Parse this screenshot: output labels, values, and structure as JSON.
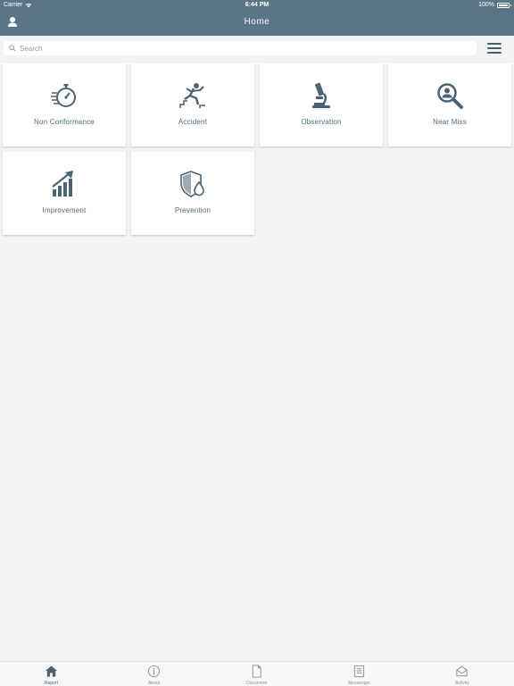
{
  "status_bar": {
    "carrier": "Carrier",
    "time": "6:44 PM",
    "battery": "100%",
    "battery_level": 1.0
  },
  "nav": {
    "title": "Home"
  },
  "search": {
    "placeholder": "Search",
    "value": ""
  },
  "tiles": [
    {
      "label": "Non Conformance",
      "icon": "stopwatch-icon"
    },
    {
      "label": "Accident",
      "icon": "falling-person-icon"
    },
    {
      "label": "Observation",
      "icon": "microscope-icon"
    },
    {
      "label": "Near Miss",
      "icon": "magnifier-person-icon"
    },
    {
      "label": "Improvement",
      "icon": "growth-chart-icon"
    },
    {
      "label": "Prevention",
      "icon": "shield-drop-icon"
    }
  ],
  "tabs": [
    {
      "label": "Report",
      "icon": "home-icon",
      "active": true
    },
    {
      "label": "About",
      "icon": "info-icon",
      "active": false
    },
    {
      "label": "Document",
      "icon": "document-icon",
      "active": false
    },
    {
      "label": "Messenger",
      "icon": "messenger-icon",
      "active": false
    },
    {
      "label": "Activity",
      "icon": "envelope-icon",
      "active": false
    }
  ],
  "colors": {
    "accent": "#5a7686",
    "icon": "#4a6474",
    "background": "#f3f3f3",
    "tab_inactive": "#8e8e8e"
  }
}
